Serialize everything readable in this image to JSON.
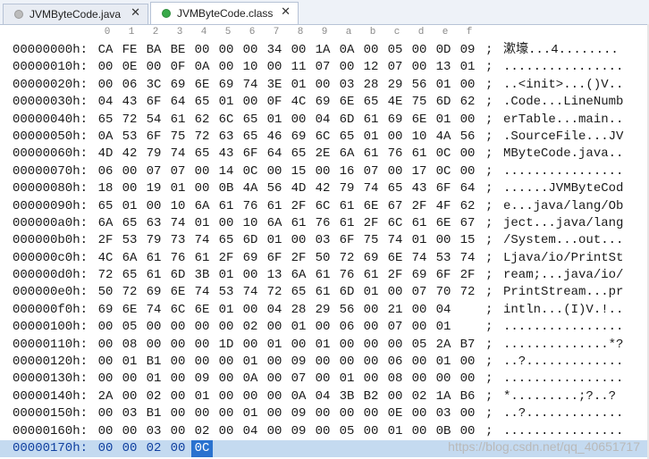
{
  "tabs": [
    {
      "label": "JVMByteCode.java",
      "close": "✕",
      "active": false
    },
    {
      "label": "JVMByteCode.class",
      "close": "✕",
      "active": true
    }
  ],
  "ruler": [
    "0",
    "1",
    "2",
    "3",
    "4",
    "5",
    "6",
    "7",
    "8",
    "9",
    "a",
    "b",
    "c",
    "d",
    "e",
    "f"
  ],
  "rows": [
    {
      "addr": "00000000h:",
      "bytes": [
        "CA",
        "FE",
        "BA",
        "BE",
        "00",
        "00",
        "00",
        "34",
        "00",
        "1A",
        "0A",
        "00",
        "05",
        "00",
        "0D",
        "09"
      ],
      "sep": ";",
      "ascii": "漱壕...4........"
    },
    {
      "addr": "00000010h:",
      "bytes": [
        "00",
        "0E",
        "00",
        "0F",
        "0A",
        "00",
        "10",
        "00",
        "11",
        "07",
        "00",
        "12",
        "07",
        "00",
        "13",
        "01"
      ],
      "sep": ";",
      "ascii": "................"
    },
    {
      "addr": "00000020h:",
      "bytes": [
        "00",
        "06",
        "3C",
        "69",
        "6E",
        "69",
        "74",
        "3E",
        "01",
        "00",
        "03",
        "28",
        "29",
        "56",
        "01",
        "00"
      ],
      "sep": ";",
      "ascii": "..<init>...()V.."
    },
    {
      "addr": "00000030h:",
      "bytes": [
        "04",
        "43",
        "6F",
        "64",
        "65",
        "01",
        "00",
        "0F",
        "4C",
        "69",
        "6E",
        "65",
        "4E",
        "75",
        "6D",
        "62"
      ],
      "sep": ";",
      "ascii": ".Code...LineNumb"
    },
    {
      "addr": "00000040h:",
      "bytes": [
        "65",
        "72",
        "54",
        "61",
        "62",
        "6C",
        "65",
        "01",
        "00",
        "04",
        "6D",
        "61",
        "69",
        "6E",
        "01",
        "00"
      ],
      "sep": ";",
      "ascii": "erTable...main.."
    },
    {
      "addr": "00000050h:",
      "bytes": [
        "0A",
        "53",
        "6F",
        "75",
        "72",
        "63",
        "65",
        "46",
        "69",
        "6C",
        "65",
        "01",
        "00",
        "10",
        "4A",
        "56"
      ],
      "sep": ";",
      "ascii": ".SourceFile...JV"
    },
    {
      "addr": "00000060h:",
      "bytes": [
        "4D",
        "42",
        "79",
        "74",
        "65",
        "43",
        "6F",
        "64",
        "65",
        "2E",
        "6A",
        "61",
        "76",
        "61",
        "0C",
        "00"
      ],
      "sep": ";",
      "ascii": "MByteCode.java.."
    },
    {
      "addr": "00000070h:",
      "bytes": [
        "06",
        "00",
        "07",
        "07",
        "00",
        "14",
        "0C",
        "00",
        "15",
        "00",
        "16",
        "07",
        "00",
        "17",
        "0C",
        "00"
      ],
      "sep": ";",
      "ascii": "................"
    },
    {
      "addr": "00000080h:",
      "bytes": [
        "18",
        "00",
        "19",
        "01",
        "00",
        "0B",
        "4A",
        "56",
        "4D",
        "42",
        "79",
        "74",
        "65",
        "43",
        "6F",
        "64"
      ],
      "sep": ";",
      "ascii": "......JVMByteCod"
    },
    {
      "addr": "00000090h:",
      "bytes": [
        "65",
        "01",
        "00",
        "10",
        "6A",
        "61",
        "76",
        "61",
        "2F",
        "6C",
        "61",
        "6E",
        "67",
        "2F",
        "4F",
        "62"
      ],
      "sep": ";",
      "ascii": "e...java/lang/Ob"
    },
    {
      "addr": "000000a0h:",
      "bytes": [
        "6A",
        "65",
        "63",
        "74",
        "01",
        "00",
        "10",
        "6A",
        "61",
        "76",
        "61",
        "2F",
        "6C",
        "61",
        "6E",
        "67"
      ],
      "sep": ";",
      "ascii": "ject...java/lang"
    },
    {
      "addr": "000000b0h:",
      "bytes": [
        "2F",
        "53",
        "79",
        "73",
        "74",
        "65",
        "6D",
        "01",
        "00",
        "03",
        "6F",
        "75",
        "74",
        "01",
        "00",
        "15"
      ],
      "sep": ";",
      "ascii": "/System...out..."
    },
    {
      "addr": "000000c0h:",
      "bytes": [
        "4C",
        "6A",
        "61",
        "76",
        "61",
        "2F",
        "69",
        "6F",
        "2F",
        "50",
        "72",
        "69",
        "6E",
        "74",
        "53",
        "74"
      ],
      "sep": ";",
      "ascii": "Ljava/io/PrintSt"
    },
    {
      "addr": "000000d0h:",
      "bytes": [
        "72",
        "65",
        "61",
        "6D",
        "3B",
        "01",
        "00",
        "13",
        "6A",
        "61",
        "76",
        "61",
        "2F",
        "69",
        "6F",
        "2F"
      ],
      "sep": ";",
      "ascii": "ream;...java/io/"
    },
    {
      "addr": "000000e0h:",
      "bytes": [
        "50",
        "72",
        "69",
        "6E",
        "74",
        "53",
        "74",
        "72",
        "65",
        "61",
        "6D",
        "01",
        "00",
        "07",
        "70",
        "72"
      ],
      "sep": ";",
      "ascii": "PrintStream...pr"
    },
    {
      "addr": "000000f0h:",
      "bytes": [
        "69",
        "6E",
        "74",
        "6C",
        "6E",
        "01",
        "00",
        "04",
        "28",
        "29",
        "56",
        "00",
        "21",
        "00",
        "04"
      ],
      "sep": ";",
      "ascii": "intln...(I)V.!.."
    },
    {
      "addr": "00000100h:",
      "bytes": [
        "00",
        "05",
        "00",
        "00",
        "00",
        "00",
        "02",
        "00",
        "01",
        "00",
        "06",
        "00",
        "07",
        "00",
        "01"
      ],
      "sep": ";",
      "ascii": "................"
    },
    {
      "addr": "00000110h:",
      "bytes": [
        "00",
        "08",
        "00",
        "00",
        "00",
        "1D",
        "00",
        "01",
        "00",
        "01",
        "00",
        "00",
        "00",
        "05",
        "2A",
        "B7"
      ],
      "sep": ";",
      "ascii": "..............*?"
    },
    {
      "addr": "00000120h:",
      "bytes": [
        "00",
        "01",
        "B1",
        "00",
        "00",
        "00",
        "01",
        "00",
        "09",
        "00",
        "00",
        "00",
        "06",
        "00",
        "01",
        "00"
      ],
      "sep": ";",
      "ascii": "..?............."
    },
    {
      "addr": "00000130h:",
      "bytes": [
        "00",
        "00",
        "01",
        "00",
        "09",
        "00",
        "0A",
        "00",
        "07",
        "00",
        "01",
        "00",
        "08",
        "00",
        "00",
        "00"
      ],
      "sep": ";",
      "ascii": "................"
    },
    {
      "addr": "00000140h:",
      "bytes": [
        "2A",
        "00",
        "02",
        "00",
        "01",
        "00",
        "00",
        "00",
        "0A",
        "04",
        "3B",
        "B2",
        "00",
        "02",
        "1A",
        "B6"
      ],
      "sep": ";",
      "ascii": "*.........;?..?"
    },
    {
      "addr": "00000150h:",
      "bytes": [
        "00",
        "03",
        "B1",
        "00",
        "00",
        "00",
        "01",
        "00",
        "09",
        "00",
        "00",
        "00",
        "0E",
        "00",
        "03",
        "00"
      ],
      "sep": ";",
      "ascii": "..?............."
    },
    {
      "addr": "00000160h:",
      "bytes": [
        "00",
        "00",
        "03",
        "00",
        "02",
        "00",
        "04",
        "00",
        "09",
        "00",
        "05",
        "00",
        "01",
        "00",
        "0B",
        "00"
      ],
      "sep": ";",
      "ascii": "................"
    },
    {
      "addr": "00000170h:",
      "bytes": [
        "00",
        "00",
        "02",
        "00",
        "0C"
      ],
      "sep": "",
      "ascii": "",
      "selected": true
    }
  ],
  "watermark": "https://blog.csdn.net/qq_40651717",
  "colors": {
    "selection_row": "#c4daf0",
    "cursor_cell": "#2a72cf",
    "active_tab_dot": "#39a94a",
    "inactive_tab_dot": "#bcbcbc"
  }
}
